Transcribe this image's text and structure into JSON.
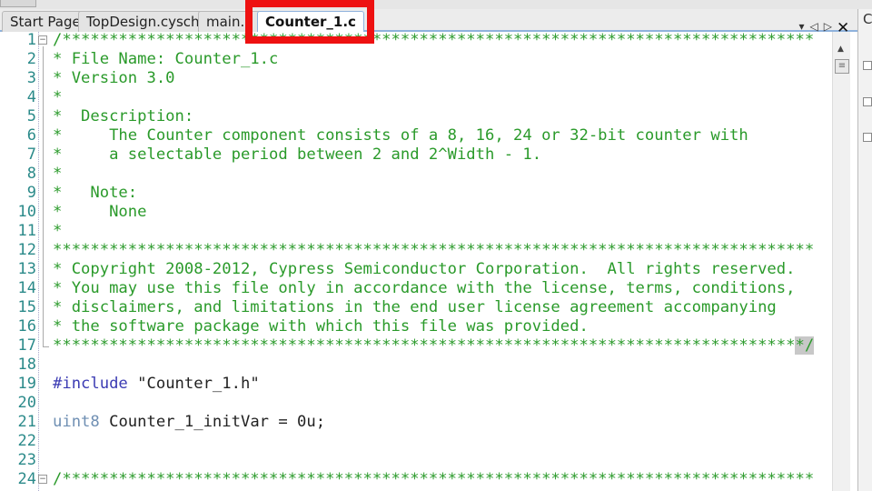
{
  "tabs": [
    {
      "label": "Start Page"
    },
    {
      "label": "TopDesign.cysch"
    },
    {
      "label": "main.c"
    },
    {
      "label": "Counter_1.c"
    }
  ],
  "right_panel": {
    "title": "C"
  },
  "code_lines": [
    [
      [
        "c",
        "/********************************************************************************"
      ]
    ],
    [
      [
        "c",
        "* File Name: Counter_1.c"
      ]
    ],
    [
      [
        "c",
        "* Version 3.0"
      ]
    ],
    [
      [
        "c",
        "*"
      ]
    ],
    [
      [
        "c",
        "*  Description:"
      ]
    ],
    [
      [
        "c",
        "*     The Counter component consists of a 8, 16, 24 or 32-bit counter with"
      ]
    ],
    [
      [
        "c",
        "*     a selectable period between 2 and 2^Width - 1."
      ]
    ],
    [
      [
        "c",
        "*"
      ]
    ],
    [
      [
        "c",
        "*   Note:"
      ]
    ],
    [
      [
        "c",
        "*     None"
      ]
    ],
    [
      [
        "c",
        "*"
      ]
    ],
    [
      [
        "c",
        "*********************************************************************************"
      ]
    ],
    [
      [
        "c",
        "* Copyright 2008-2012, Cypress Semiconductor Corporation.  All rights reserved."
      ]
    ],
    [
      [
        "c",
        "* You may use this file only in accordance with the license, terms, conditions,"
      ]
    ],
    [
      [
        "c",
        "* disclaimers, and limitations in the end user license agreement accompanying"
      ]
    ],
    [
      [
        "c",
        "* the software package with which this file was provided."
      ]
    ],
    [
      [
        "c",
        "*******************************************************************************"
      ],
      [
        "c sel",
        "*/"
      ]
    ],
    [],
    [
      [
        "k",
        "#include"
      ],
      [
        "s",
        " \"Counter_1.h\""
      ]
    ],
    [],
    [
      [
        "t",
        "uint8"
      ],
      [
        "s",
        " Counter_1_initVar = 0u;"
      ]
    ],
    [],
    [],
    [
      [
        "c",
        "/********************************************************************************"
      ]
    ]
  ]
}
